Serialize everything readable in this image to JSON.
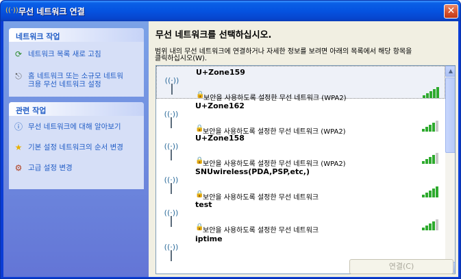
{
  "window": {
    "title": "무선 네트워크 연결",
    "close_label": "✕"
  },
  "sidebar": {
    "network_tasks": {
      "heading": "네트워크 작업",
      "items": [
        {
          "label": "네트워크 목록 새로 고침",
          "icon": "refresh-icon"
        },
        {
          "label_line1": "홈 네트워크 또는 소규모 네트워",
          "label_line2": "크용 무선 네트워크 설정",
          "icon": "network-setup-icon"
        }
      ]
    },
    "related_tasks": {
      "heading": "관련 작업",
      "items": [
        {
          "label": "무선 네트워크에 대해 알아보기",
          "icon": "info-icon"
        },
        {
          "label": "기본 설정 네트워크의 순서 변경",
          "icon": "star-icon"
        },
        {
          "label": "고급 설정 변경",
          "icon": "settings-icon"
        }
      ]
    }
  },
  "main": {
    "heading": "무선 네트워크를 선택하십시오.",
    "description_line1": "범위 내의 무선 네트워크에 연결하거나 자세한 정보를 보려면 아래의 목록에서 해당 항목을",
    "description_line2": "클릭하십시오(W).",
    "networks": [
      {
        "ssid": "U+Zone159",
        "security": "보안을 사용하도록 설정한 무선 네트워크 (WPA2)",
        "signal_bars": 5
      },
      {
        "ssid": "U+Zone162",
        "security": "보안을 사용하도록 설정한 무선 네트워크 (WPA2)",
        "signal_bars": 4
      },
      {
        "ssid": "U+Zone158",
        "security": "보안을 사용하도록 설정한 무선 네트워크 (WPA2)",
        "signal_bars": 4
      },
      {
        "ssid": "SNUwireless(PDA,PSP,etc,)",
        "security": "보안을 사용하도록 설정한 무선 네트워크",
        "signal_bars": 5
      },
      {
        "ssid": "test",
        "security": "보안을 사용하도록 설정한 무선 네트워크",
        "signal_bars": 4
      },
      {
        "ssid": "iptime",
        "security": "",
        "signal_bars": 0
      }
    ],
    "connect_label": "연결(C)"
  },
  "colors": {
    "accent": "#215dc6",
    "signal_strong": "#2eaa2e",
    "signal_weak": "#c8c8c8",
    "title_bar": "#0553e0"
  }
}
